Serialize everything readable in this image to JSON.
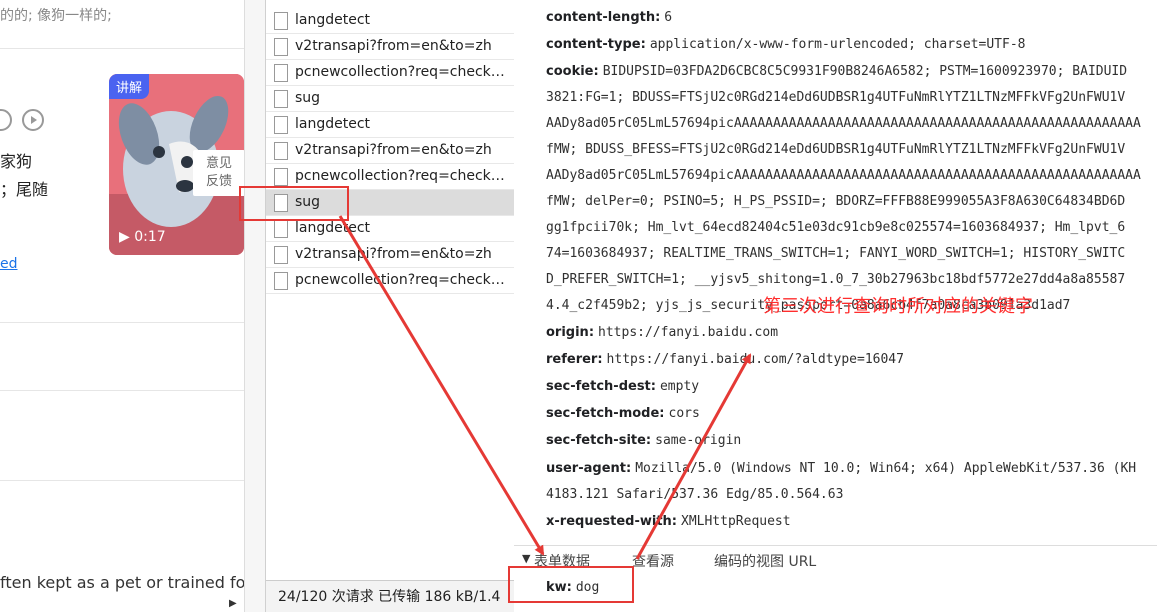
{
  "left_page": {
    "hint_text": "的的; 像狗一样的;",
    "meaning_lines": [
      "家狗",
      "；尾随"
    ],
    "link_text": "ed",
    "sentence_fragment": "ften kept as a pet or trained for v",
    "thumbnail": {
      "tag": "讲解",
      "duration": "0:17",
      "feedback": [
        "意见",
        "反馈"
      ]
    }
  },
  "network": {
    "requests": [
      {
        "name": "langdetect",
        "selected": false
      },
      {
        "name": "v2transapi?from=en&to=zh",
        "selected": false
      },
      {
        "name": "pcnewcollection?req=check&f...",
        "selected": false
      },
      {
        "name": "sug",
        "selected": false
      },
      {
        "name": "langdetect",
        "selected": false
      },
      {
        "name": "v2transapi?from=en&to=zh",
        "selected": false
      },
      {
        "name": "pcnewcollection?req=check&f...",
        "selected": false
      },
      {
        "name": "sug",
        "selected": true
      },
      {
        "name": "langdetect",
        "selected": false
      },
      {
        "name": "v2transapi?from=en&to=zh",
        "selected": false
      },
      {
        "name": "pcnewcollection?req=check&f...",
        "selected": false
      }
    ],
    "summary": "24/120 次请求  已传输 186 kB/1.4"
  },
  "headers": {
    "content_length": {
      "key": "content-length:",
      "value": "6"
    },
    "content_type": {
      "key": "content-type:",
      "value": "application/x-www-form-urlencoded; charset=UTF-8"
    },
    "cookie": {
      "key": "cookie:",
      "first": "BIDUPSID=03FDA2D6CBC8C5C9931F90B8246A6582; PSTM=1600923970; BAIDUID",
      "continued": [
        "3821:FG=1; BDUSS=FTSjU2c0RGd214eDd6UDBSR1g4UTFuNmRlYTZ1LTNzMFFkVFg2UnFWU1V",
        "AADy8ad05rC05LmL57694picAAAAAAAAAAAAAAAAAAAAAAAAAAAAAAAAAAAAAAAAAAAAAAAAAAAA",
        "fMW; BDUSS_BFESS=FTSjU2c0RGd214eDd6UDBSR1g4UTFuNmRlYTZ1LTNzMFFkVFg2UnFWU1V",
        "AADy8ad05rC05LmL57694picAAAAAAAAAAAAAAAAAAAAAAAAAAAAAAAAAAAAAAAAAAAAAAAAAAAA",
        "fMW; delPer=0; PSINO=5; H_PS_PSSID=; BDORZ=FFFB88E999055A3F8A630C64834BD6D",
        "gg1fpcii70k; Hm_lvt_64ecd82404c51e03dc91cb9e8c025574=1603684937; Hm_lpvt_6",
        "74=1603684937; REALTIME_TRANS_SWITCH=1; FANYI_WORD_SWITCH=1; HISTORY_SWITC",
        "D_PREFER_SWITCH=1; __yjsv5_shitong=1.0_7_30b27963bc18bdf5772e27dd4a8a85587",
        "4.4_c2f459b2; yjs_js_security_passport=0a8a6cb4f7a0a8ca3b091a3d1ad7"
      ]
    },
    "origin": {
      "key": "origin:",
      "value": "https://fanyi.baidu.com"
    },
    "referer": {
      "key": "referer:",
      "value": "https://fanyi.baidu.com/?aldtype=16047"
    },
    "sec_fetch_dest": {
      "key": "sec-fetch-dest:",
      "value": "empty"
    },
    "sec_fetch_mode": {
      "key": "sec-fetch-mode:",
      "value": "cors"
    },
    "sec_fetch_site": {
      "key": "sec-fetch-site:",
      "value": "same-origin"
    },
    "user_agent": {
      "key": "user-agent:",
      "value": "Mozilla/5.0 (Windows NT 10.0; Win64; x64) AppleWebKit/537.36 (KH",
      "continued": "4183.121 Safari/537.36 Edg/85.0.564.63"
    },
    "x_requested_with": {
      "key": "x-requested-with:",
      "value": "XMLHttpRequest"
    }
  },
  "form_data": {
    "section_title": "表单数据",
    "view_source": "查看源",
    "view_url_encoded": "编码的视图 URL",
    "key": "kw:",
    "value": "dog"
  },
  "annotation": {
    "text": "第三次进行查询时所对应的关键字",
    "color": "#e53935"
  }
}
